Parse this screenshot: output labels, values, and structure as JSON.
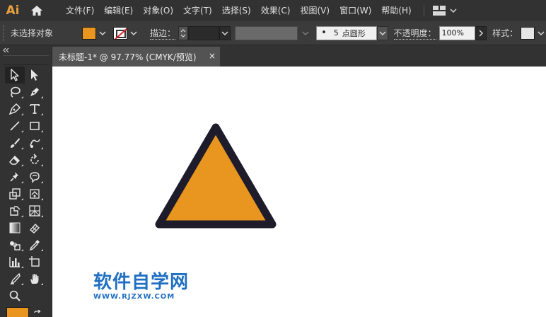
{
  "app": {
    "logo": "Ai"
  },
  "menu": [
    "文件(F)",
    "编辑(E)",
    "对象(O)",
    "文字(T)",
    "选择(S)",
    "效果(C)",
    "视图(V)",
    "窗口(W)",
    "帮助(H)"
  ],
  "control_bar": {
    "selection_status": "未选择对象",
    "stroke_label": "描边：",
    "brush_dot": "•",
    "brush_value": "5",
    "brush_label": "点圆形",
    "opacity_label": "不透明度：",
    "opacity_value": "100%",
    "style_label": "样式："
  },
  "tab": {
    "title": "未标题-1* @ 97.77% (CMYK/预览)",
    "close": "×"
  },
  "watermark": {
    "title": "软件自学网",
    "url": "WWW.RJZXW.COM"
  },
  "colors": {
    "fill": "#e8961f",
    "stroke": "#1e1c2a",
    "watermark": "#1f6fc2",
    "logo": "#e8a03d"
  }
}
